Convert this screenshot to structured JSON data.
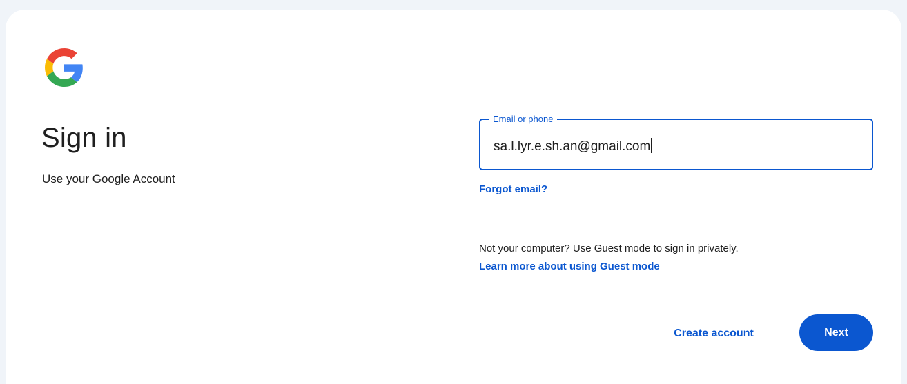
{
  "brand": {
    "logo_icon": "google-g-logo-icon",
    "colors": {
      "blue": "#4285F4",
      "red": "#EA4335",
      "yellow": "#FBBC05",
      "green": "#34A853"
    }
  },
  "header": {
    "title": "Sign in",
    "subtitle": "Use your Google Account"
  },
  "form": {
    "email_label": "Email or phone",
    "email_value": "sa.l.lyr.e.sh.an@gmail.com",
    "forgot_email_label": "Forgot email?",
    "guest_text": "Not your computer? Use Guest mode to sign in privately.",
    "guest_link_label": "Learn more about using Guest mode"
  },
  "actions": {
    "create_account_label": "Create account",
    "next_label": "Next"
  },
  "theme": {
    "accent": "#0b57d0",
    "text": "#1f1f1f",
    "page_background": "#f0f4f9",
    "card_background": "#ffffff"
  }
}
